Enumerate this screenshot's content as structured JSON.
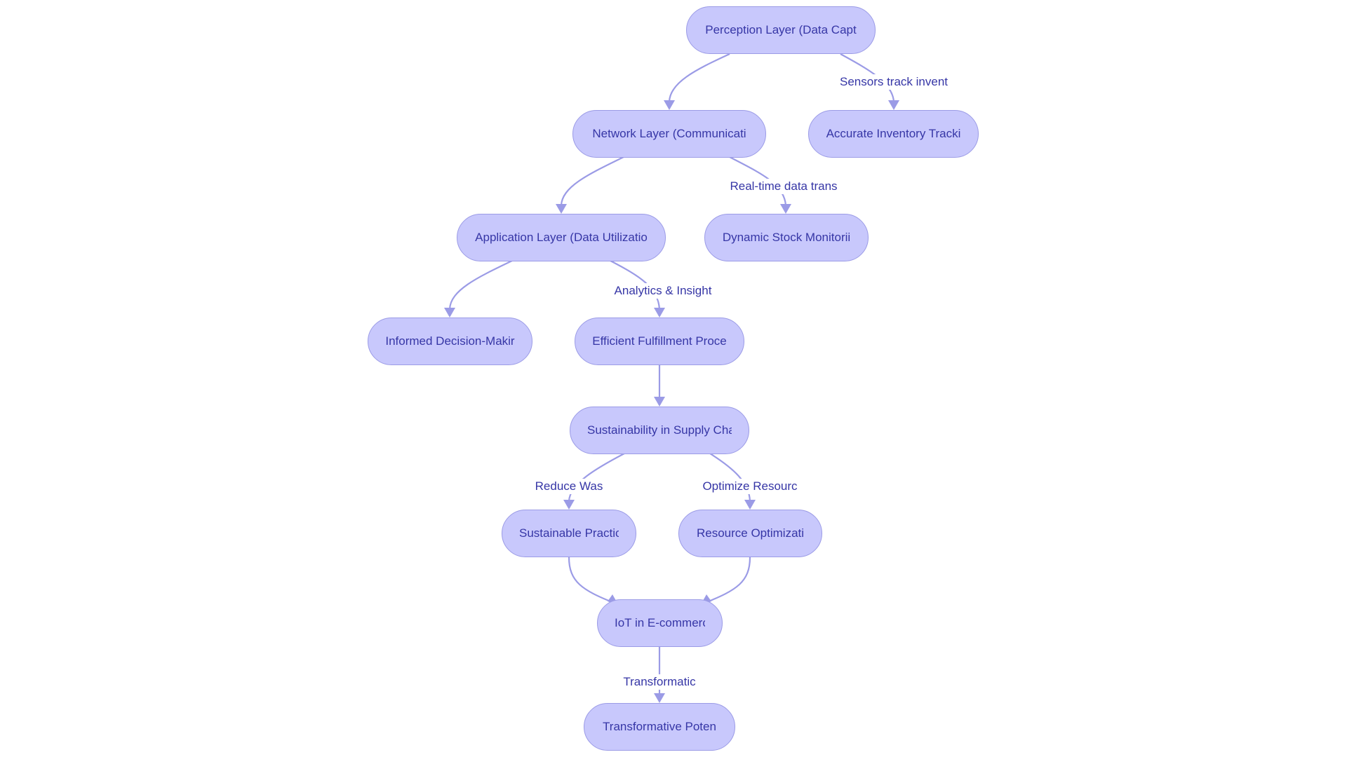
{
  "diagram": {
    "type": "flowchart",
    "direction": "top-down",
    "colors": {
      "node_fill": "#c8c8fc",
      "node_border": "#9b9be6",
      "text": "#3636a6",
      "edge": "#9b9be6",
      "background": "#ffffff"
    },
    "nodes": [
      {
        "id": "perception",
        "label": "Perception Layer (Data Capt"
      },
      {
        "id": "network",
        "label": "Network Layer (Communicati"
      },
      {
        "id": "accurate",
        "label": "Accurate Inventory Tracki"
      },
      {
        "id": "application",
        "label": "Application Layer (Data Utilizatio"
      },
      {
        "id": "dynamic",
        "label": "Dynamic Stock Monitorii"
      },
      {
        "id": "informed",
        "label": "Informed Decision-Makir"
      },
      {
        "id": "efficient",
        "label": "Efficient Fulfillment Proce"
      },
      {
        "id": "sustainability",
        "label": "Sustainability in Supply Cha"
      },
      {
        "id": "practices",
        "label": "Sustainable Practic"
      },
      {
        "id": "resource",
        "label": "Resource Optimizati"
      },
      {
        "id": "iot",
        "label": "IoT in E-commerc"
      },
      {
        "id": "transformative",
        "label": "Transformative Poten"
      }
    ],
    "edges": [
      {
        "from": "perception",
        "to": "network",
        "label": ""
      },
      {
        "from": "perception",
        "to": "accurate",
        "label": "Sensors track invent"
      },
      {
        "from": "network",
        "to": "application",
        "label": ""
      },
      {
        "from": "network",
        "to": "dynamic",
        "label": "Real-time data trans"
      },
      {
        "from": "application",
        "to": "informed",
        "label": ""
      },
      {
        "from": "application",
        "to": "efficient",
        "label": "Analytics & Insight"
      },
      {
        "from": "efficient",
        "to": "sustainability",
        "label": ""
      },
      {
        "from": "sustainability",
        "to": "practices",
        "label": "Reduce Was"
      },
      {
        "from": "sustainability",
        "to": "resource",
        "label": "Optimize Resourc"
      },
      {
        "from": "practices",
        "to": "iot",
        "label": ""
      },
      {
        "from": "resource",
        "to": "iot",
        "label": ""
      },
      {
        "from": "iot",
        "to": "transformative",
        "label": "Transformatic"
      }
    ]
  }
}
